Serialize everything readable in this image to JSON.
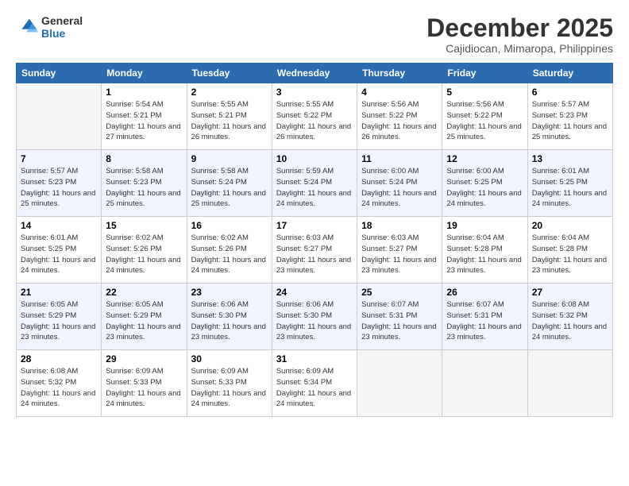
{
  "logo": {
    "line1": "General",
    "line2": "Blue"
  },
  "title": "December 2025",
  "subtitle": "Cajidiocan, Mimaropa, Philippines",
  "days_of_week": [
    "Sunday",
    "Monday",
    "Tuesday",
    "Wednesday",
    "Thursday",
    "Friday",
    "Saturday"
  ],
  "weeks": [
    [
      {
        "day": "",
        "sunrise": "",
        "sunset": "",
        "daylight": ""
      },
      {
        "day": "1",
        "sunrise": "Sunrise: 5:54 AM",
        "sunset": "Sunset: 5:21 PM",
        "daylight": "Daylight: 11 hours and 27 minutes."
      },
      {
        "day": "2",
        "sunrise": "Sunrise: 5:55 AM",
        "sunset": "Sunset: 5:21 PM",
        "daylight": "Daylight: 11 hours and 26 minutes."
      },
      {
        "day": "3",
        "sunrise": "Sunrise: 5:55 AM",
        "sunset": "Sunset: 5:22 PM",
        "daylight": "Daylight: 11 hours and 26 minutes."
      },
      {
        "day": "4",
        "sunrise": "Sunrise: 5:56 AM",
        "sunset": "Sunset: 5:22 PM",
        "daylight": "Daylight: 11 hours and 26 minutes."
      },
      {
        "day": "5",
        "sunrise": "Sunrise: 5:56 AM",
        "sunset": "Sunset: 5:22 PM",
        "daylight": "Daylight: 11 hours and 25 minutes."
      },
      {
        "day": "6",
        "sunrise": "Sunrise: 5:57 AM",
        "sunset": "Sunset: 5:23 PM",
        "daylight": "Daylight: 11 hours and 25 minutes."
      }
    ],
    [
      {
        "day": "7",
        "sunrise": "Sunrise: 5:57 AM",
        "sunset": "Sunset: 5:23 PM",
        "daylight": "Daylight: 11 hours and 25 minutes."
      },
      {
        "day": "8",
        "sunrise": "Sunrise: 5:58 AM",
        "sunset": "Sunset: 5:23 PM",
        "daylight": "Daylight: 11 hours and 25 minutes."
      },
      {
        "day": "9",
        "sunrise": "Sunrise: 5:58 AM",
        "sunset": "Sunset: 5:24 PM",
        "daylight": "Daylight: 11 hours and 25 minutes."
      },
      {
        "day": "10",
        "sunrise": "Sunrise: 5:59 AM",
        "sunset": "Sunset: 5:24 PM",
        "daylight": "Daylight: 11 hours and 24 minutes."
      },
      {
        "day": "11",
        "sunrise": "Sunrise: 6:00 AM",
        "sunset": "Sunset: 5:24 PM",
        "daylight": "Daylight: 11 hours and 24 minutes."
      },
      {
        "day": "12",
        "sunrise": "Sunrise: 6:00 AM",
        "sunset": "Sunset: 5:25 PM",
        "daylight": "Daylight: 11 hours and 24 minutes."
      },
      {
        "day": "13",
        "sunrise": "Sunrise: 6:01 AM",
        "sunset": "Sunset: 5:25 PM",
        "daylight": "Daylight: 11 hours and 24 minutes."
      }
    ],
    [
      {
        "day": "14",
        "sunrise": "Sunrise: 6:01 AM",
        "sunset": "Sunset: 5:25 PM",
        "daylight": "Daylight: 11 hours and 24 minutes."
      },
      {
        "day": "15",
        "sunrise": "Sunrise: 6:02 AM",
        "sunset": "Sunset: 5:26 PM",
        "daylight": "Daylight: 11 hours and 24 minutes."
      },
      {
        "day": "16",
        "sunrise": "Sunrise: 6:02 AM",
        "sunset": "Sunset: 5:26 PM",
        "daylight": "Daylight: 11 hours and 24 minutes."
      },
      {
        "day": "17",
        "sunrise": "Sunrise: 6:03 AM",
        "sunset": "Sunset: 5:27 PM",
        "daylight": "Daylight: 11 hours and 23 minutes."
      },
      {
        "day": "18",
        "sunrise": "Sunrise: 6:03 AM",
        "sunset": "Sunset: 5:27 PM",
        "daylight": "Daylight: 11 hours and 23 minutes."
      },
      {
        "day": "19",
        "sunrise": "Sunrise: 6:04 AM",
        "sunset": "Sunset: 5:28 PM",
        "daylight": "Daylight: 11 hours and 23 minutes."
      },
      {
        "day": "20",
        "sunrise": "Sunrise: 6:04 AM",
        "sunset": "Sunset: 5:28 PM",
        "daylight": "Daylight: 11 hours and 23 minutes."
      }
    ],
    [
      {
        "day": "21",
        "sunrise": "Sunrise: 6:05 AM",
        "sunset": "Sunset: 5:29 PM",
        "daylight": "Daylight: 11 hours and 23 minutes."
      },
      {
        "day": "22",
        "sunrise": "Sunrise: 6:05 AM",
        "sunset": "Sunset: 5:29 PM",
        "daylight": "Daylight: 11 hours and 23 minutes."
      },
      {
        "day": "23",
        "sunrise": "Sunrise: 6:06 AM",
        "sunset": "Sunset: 5:30 PM",
        "daylight": "Daylight: 11 hours and 23 minutes."
      },
      {
        "day": "24",
        "sunrise": "Sunrise: 6:06 AM",
        "sunset": "Sunset: 5:30 PM",
        "daylight": "Daylight: 11 hours and 23 minutes."
      },
      {
        "day": "25",
        "sunrise": "Sunrise: 6:07 AM",
        "sunset": "Sunset: 5:31 PM",
        "daylight": "Daylight: 11 hours and 23 minutes."
      },
      {
        "day": "26",
        "sunrise": "Sunrise: 6:07 AM",
        "sunset": "Sunset: 5:31 PM",
        "daylight": "Daylight: 11 hours and 23 minutes."
      },
      {
        "day": "27",
        "sunrise": "Sunrise: 6:08 AM",
        "sunset": "Sunset: 5:32 PM",
        "daylight": "Daylight: 11 hours and 24 minutes."
      }
    ],
    [
      {
        "day": "28",
        "sunrise": "Sunrise: 6:08 AM",
        "sunset": "Sunset: 5:32 PM",
        "daylight": "Daylight: 11 hours and 24 minutes."
      },
      {
        "day": "29",
        "sunrise": "Sunrise: 6:09 AM",
        "sunset": "Sunset: 5:33 PM",
        "daylight": "Daylight: 11 hours and 24 minutes."
      },
      {
        "day": "30",
        "sunrise": "Sunrise: 6:09 AM",
        "sunset": "Sunset: 5:33 PM",
        "daylight": "Daylight: 11 hours and 24 minutes."
      },
      {
        "day": "31",
        "sunrise": "Sunrise: 6:09 AM",
        "sunset": "Sunset: 5:34 PM",
        "daylight": "Daylight: 11 hours and 24 minutes."
      },
      {
        "day": "",
        "sunrise": "",
        "sunset": "",
        "daylight": ""
      },
      {
        "day": "",
        "sunrise": "",
        "sunset": "",
        "daylight": ""
      },
      {
        "day": "",
        "sunrise": "",
        "sunset": "",
        "daylight": ""
      }
    ]
  ]
}
